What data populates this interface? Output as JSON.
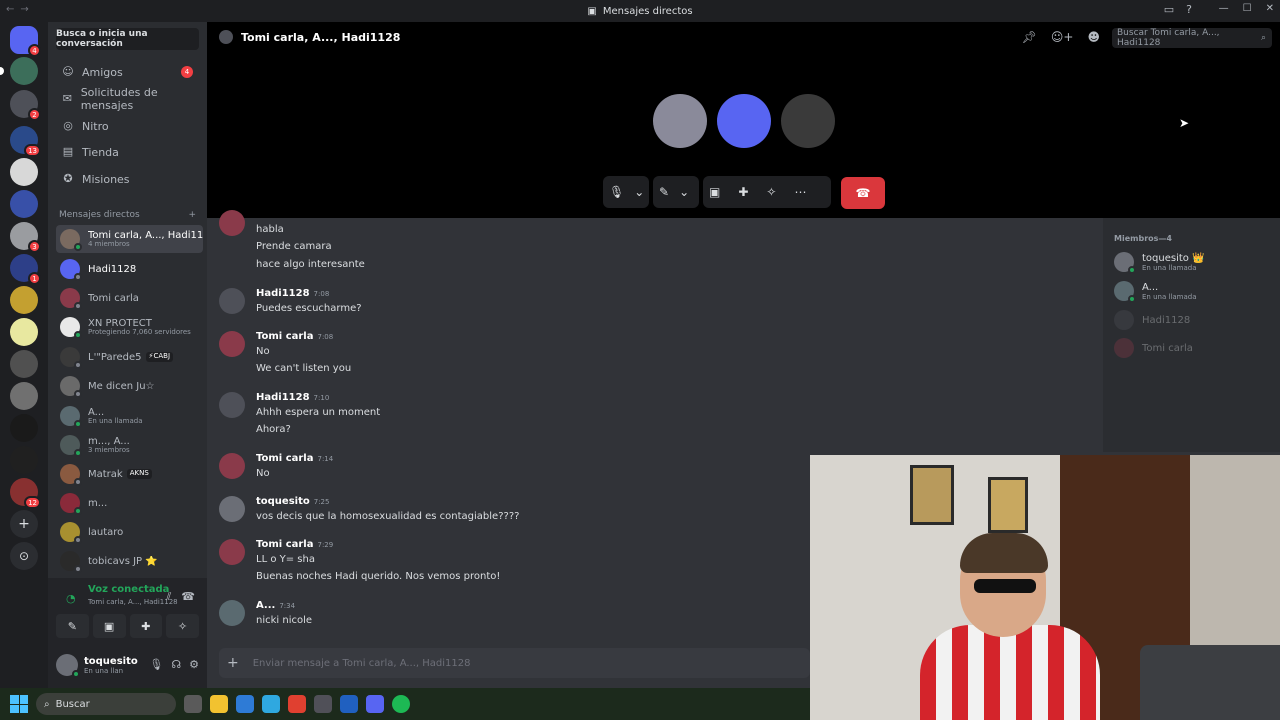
{
  "window": {
    "title": "Mensajes directos"
  },
  "servers": [
    {
      "badge": "4"
    },
    {
      "badge": ""
    },
    {
      "badge": "2"
    },
    {
      "badge": "13"
    },
    {
      "badge": ""
    },
    {
      "badge": ""
    },
    {
      "badge": "3"
    },
    {
      "badge": "1"
    },
    {
      "badge": ""
    },
    {
      "badge": ""
    },
    {
      "badge": ""
    },
    {
      "badge": ""
    },
    {
      "badge": ""
    },
    {
      "badge": ""
    },
    {
      "badge": "12"
    }
  ],
  "sidebar": {
    "search_label": "Busca o inicia una conversación",
    "nav": [
      {
        "label": "Amigos",
        "badge": "4",
        "icon": "friends-icon"
      },
      {
        "label": "Solicitudes de mensajes",
        "badge": "",
        "icon": "mail-icon"
      },
      {
        "label": "Nitro",
        "badge": "",
        "icon": "nitro-icon"
      },
      {
        "label": "Tienda",
        "badge": "",
        "icon": "shop-icon"
      },
      {
        "label": "Misiones",
        "badge": "",
        "icon": "quests-icon"
      }
    ],
    "dm_header": "Mensajes directos",
    "dms": [
      {
        "name": "Tomi carla, A..., Hadi11...",
        "sub": "4 miembros",
        "tag": ""
      },
      {
        "name": "Hadi1128",
        "sub": "",
        "tag": ""
      },
      {
        "name": "Tomi carla",
        "sub": "",
        "tag": ""
      },
      {
        "name": "XN PROTECT",
        "sub": "Protegiendo 7,060 servidores",
        "tag": ""
      },
      {
        "name": "L'\"Parede5",
        "sub": "",
        "tag": "⚡CABJ"
      },
      {
        "name": "Me dicen Ju☆",
        "sub": "",
        "tag": ""
      },
      {
        "name": "A...",
        "sub": "En una llamada",
        "tag": ""
      },
      {
        "name": "m..., A...",
        "sub": "3 miembros",
        "tag": ""
      },
      {
        "name": "Matrak",
        "sub": "",
        "tag": "AKNS"
      },
      {
        "name": "m...",
        "sub": "",
        "tag": ""
      },
      {
        "name": "lautaro",
        "sub": "",
        "tag": ""
      },
      {
        "name": "tobicavs JP ⭐",
        "sub": "",
        "tag": ""
      }
    ]
  },
  "voice": {
    "status": "Voz conectada",
    "channel": "Tomi carla, A..., Hadi1128"
  },
  "user": {
    "name": "toquesito",
    "status": "En una llan"
  },
  "call": {
    "title": "Tomi carla, A..., Hadi1128",
    "search_placeholder": "Buscar Tomi carla, A..., Hadi1128"
  },
  "messages": [
    {
      "author": "",
      "time": "",
      "lines": [
        "habla",
        "Prende camara",
        "hace algo interesante"
      ]
    },
    {
      "author": "Hadi1128",
      "time": "7:08",
      "lines": [
        "Puedes escucharme?"
      ]
    },
    {
      "author": "Tomi carla",
      "time": "7:08",
      "lines": [
        "No",
        "We can't listen you"
      ]
    },
    {
      "author": "Hadi1128",
      "time": "7:10",
      "lines": [
        "Ahhh espera un moment",
        "Ahora?"
      ]
    },
    {
      "author": "Tomi carla",
      "time": "7:14",
      "lines": [
        "No"
      ]
    },
    {
      "author": "toquesito",
      "time": "7:25",
      "lines": [
        "vos decis que la homosexualidad es contagiable????"
      ]
    },
    {
      "author": "Tomi carla",
      "time": "7:29",
      "lines": [
        "LL o Y= sha",
        "Buenas noches Hadi querido. Nos vemos pronto!"
      ]
    },
    {
      "author": "A...",
      "time": "7:34",
      "lines": [
        "nicki nicole"
      ]
    }
  ],
  "composer": {
    "placeholder": "Enviar mensaje a Tomi carla, A..., Hadi1128"
  },
  "members": {
    "header": "Miembros—4",
    "list": [
      {
        "name": "toquesito 👑",
        "sub": "En una llamada"
      },
      {
        "name": "A...",
        "sub": "En una llamada"
      },
      {
        "name": "Hadi1128",
        "sub": ""
      },
      {
        "name": "Tomi carla",
        "sub": ""
      }
    ]
  },
  "taskbar": {
    "search": "Buscar"
  },
  "colors": {
    "accent": "#5865f2",
    "danger": "#da373c",
    "online": "#23a55a"
  }
}
